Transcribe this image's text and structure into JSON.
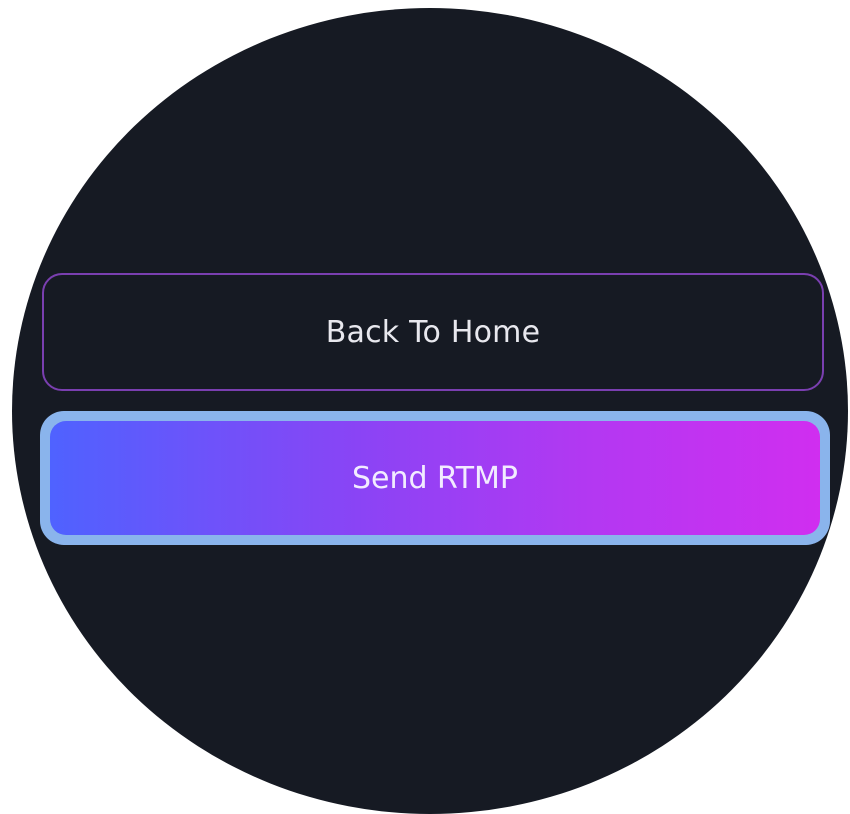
{
  "screen": {
    "background_color": "#161a23"
  },
  "buttons": {
    "back_to_home": {
      "label": "Back To Home",
      "border_color": "#7a3fb0"
    },
    "send_rtmp": {
      "label": "Send RTMP",
      "focus_ring_color": "#8ab4ec",
      "gradient_start": "#4f62ff",
      "gradient_end": "#d02ef0"
    }
  }
}
